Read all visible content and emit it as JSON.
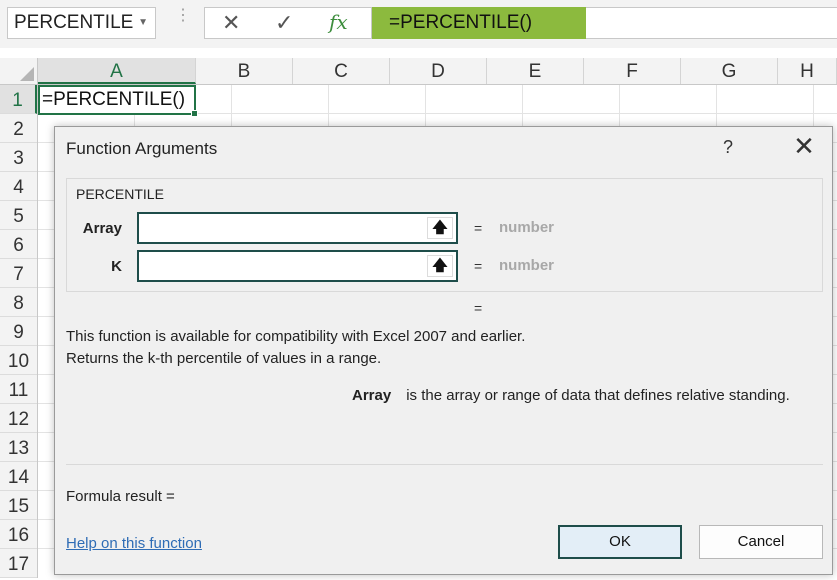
{
  "formula_bar": {
    "name_box": "PERCENTILE",
    "cancel_glyph": "✕",
    "enter_glyph": "✓",
    "fx_glyph": "fx",
    "formula": "=PERCENTILE()"
  },
  "columns": [
    "A",
    "B",
    "C",
    "D",
    "E",
    "F",
    "G",
    "H"
  ],
  "rows": [
    "1",
    "2",
    "3",
    "4",
    "5",
    "6",
    "7",
    "8",
    "9",
    "10",
    "11",
    "12",
    "13",
    "14",
    "15",
    "16",
    "17"
  ],
  "cell_a1": "=PERCENTILE()",
  "dialog": {
    "title": "Function Arguments",
    "help_glyph": "?",
    "close_glyph": "✕",
    "function_name": "PERCENTILE",
    "args": [
      {
        "label": "Array",
        "value": "",
        "equals": "=",
        "hint": "number"
      },
      {
        "label": "K",
        "value": "",
        "equals": "=",
        "hint": "number"
      }
    ],
    "collapse_glyph": "🡅",
    "result_equals": "=",
    "description_line1": "This function is available for compatibility with Excel 2007 and earlier.",
    "description_line2": "Returns the k-th percentile of values in a range.",
    "arg_name": "Array",
    "arg_description": "is the array or range of data that defines relative standing.",
    "formula_result_label": "Formula result =",
    "help_link": "Help on this function",
    "ok_label": "OK",
    "cancel_label": "Cancel"
  },
  "colors": {
    "excel_green": "#217346",
    "formula_highlight": "#8cba3e",
    "focus_border": "#1e4d4a",
    "link": "#2e6cb5"
  }
}
